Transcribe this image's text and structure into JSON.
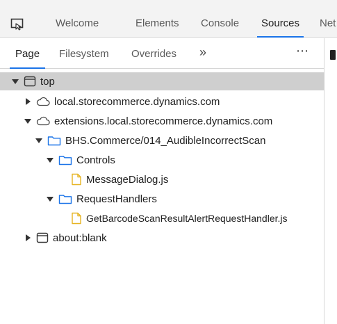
{
  "main_tabs": [
    {
      "label": "Welcome",
      "active": false
    },
    {
      "label": "Elements",
      "active": false
    },
    {
      "label": "Console",
      "active": false
    },
    {
      "label": "Sources",
      "active": true
    },
    {
      "label": "Net",
      "active": false
    }
  ],
  "sub_tabs": [
    {
      "label": "Page",
      "active": true
    },
    {
      "label": "Filesystem",
      "active": false
    },
    {
      "label": "Overrides",
      "active": false
    }
  ],
  "sub_overflow": "»",
  "more_menu": "⋯",
  "tree": {
    "top": "top",
    "local": "local.storecommerce.dynamics.com",
    "extensions": "extensions.local.storecommerce.dynamics.com",
    "bhs": "BHS.Commerce/014_AudibleIncorrectScan",
    "controls": "Controls",
    "message_dialog": "MessageDialog.js",
    "request_handlers": "RequestHandlers",
    "get_barcode": "GetBarcodeScanResultAlertRequestHandler.js",
    "about_blank": "about:blank"
  },
  "colors": {
    "accent": "#1a73e8",
    "folder": "#1a73e8",
    "file": "#e6b422",
    "selected_row": "#cfcfcf"
  }
}
